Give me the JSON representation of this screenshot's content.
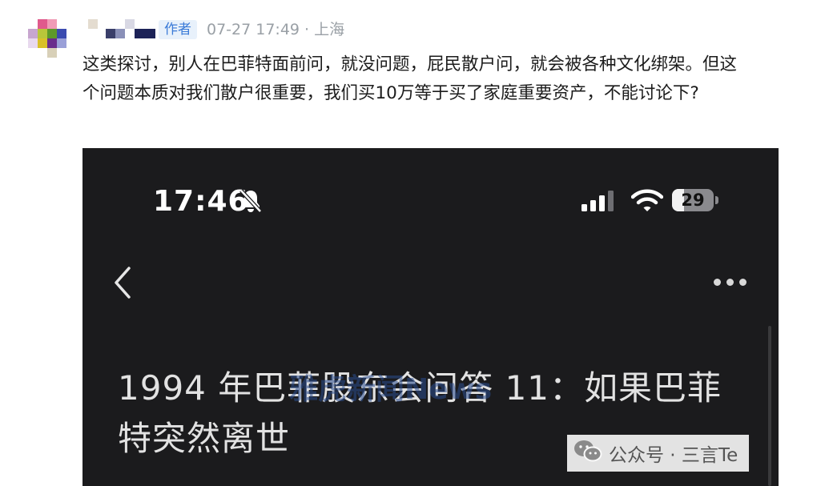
{
  "comment": {
    "author_tag": "作者",
    "meta": "07-27 17:49 · 上海",
    "text": "这类探讨，别人在巴菲特面前问，就没问题，屁民散户问，就会被各种文化绑架。但这个问题本质对我们散户很重要，我们买10万等于买了家庭重要资产，不能讨论下?"
  },
  "screenshot": {
    "status_time": "17:46",
    "battery_level": "29",
    "battery_fraction": 0.29,
    "article_title": "1994 年巴菲股东会问答 11：如果巴菲特突然离世",
    "overlay_watermark": "雅虎新闻News",
    "wechat_watermark": "公众号 · 三言Te"
  },
  "icons": {
    "bell": "bell-slash-icon",
    "signal": "cellular-signal-icon",
    "wifi": "wifi-icon",
    "back": "chevron-left-icon",
    "more": "more-dots-icon",
    "wechat": "wechat-logo-icon"
  },
  "colors": {
    "author_tag_bg": "#e8f1fb",
    "author_tag_text": "#3b7bd8",
    "meta_text": "#9aa0a6",
    "screenshot_bg": "#1b1b1d"
  }
}
